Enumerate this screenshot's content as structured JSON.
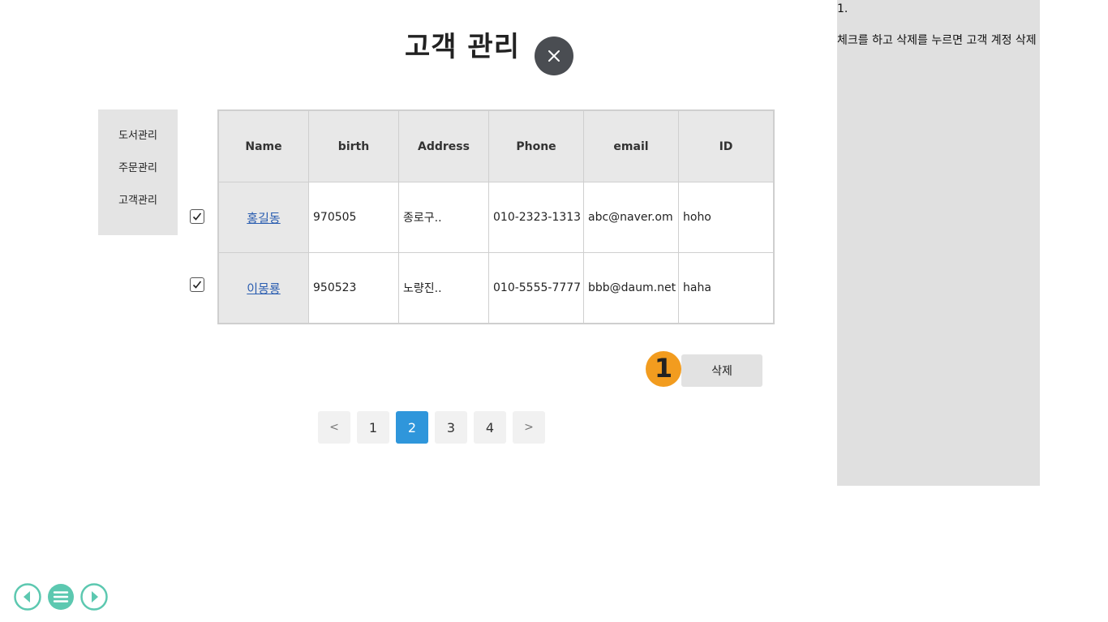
{
  "header": {
    "title": "고객 관리"
  },
  "sidebar": {
    "items": [
      {
        "label": "도서관리"
      },
      {
        "label": "주문관리"
      },
      {
        "label": "고객관리"
      }
    ]
  },
  "table": {
    "headers": [
      "Name",
      "birth",
      "Address",
      "Phone",
      "email",
      "ID"
    ],
    "rows": [
      {
        "checked": true,
        "name": "홍길동",
        "birth": "970505",
        "address": "종로구..",
        "phone": "010-2323-1313",
        "email": "abc@naver.om",
        "id": "hoho"
      },
      {
        "checked": true,
        "name": "이몽룡",
        "birth": "950523",
        "address": "노량진..",
        "phone": "010-5555-7777",
        "email": "bbb@daum.net",
        "id": "haha"
      }
    ]
  },
  "actions": {
    "delete_label": "삭제",
    "step_badge": "1"
  },
  "pagination": {
    "prev": "<",
    "pages": [
      "1",
      "2",
      "3",
      "4"
    ],
    "current": "2",
    "next": ">"
  },
  "notes": {
    "number": "1.",
    "text": "체크를 하고 삭제를 누르면 고객 계정 삭제"
  },
  "player": {
    "icons": [
      "prev-circle-icon",
      "menu-circle-icon",
      "next-circle-icon"
    ],
    "accent": "#5cc8b0"
  },
  "colors": {
    "badge": "#f29c1f",
    "active_page": "#2f96db",
    "close_button": "#4a4d52",
    "link": "#2a5db0"
  }
}
